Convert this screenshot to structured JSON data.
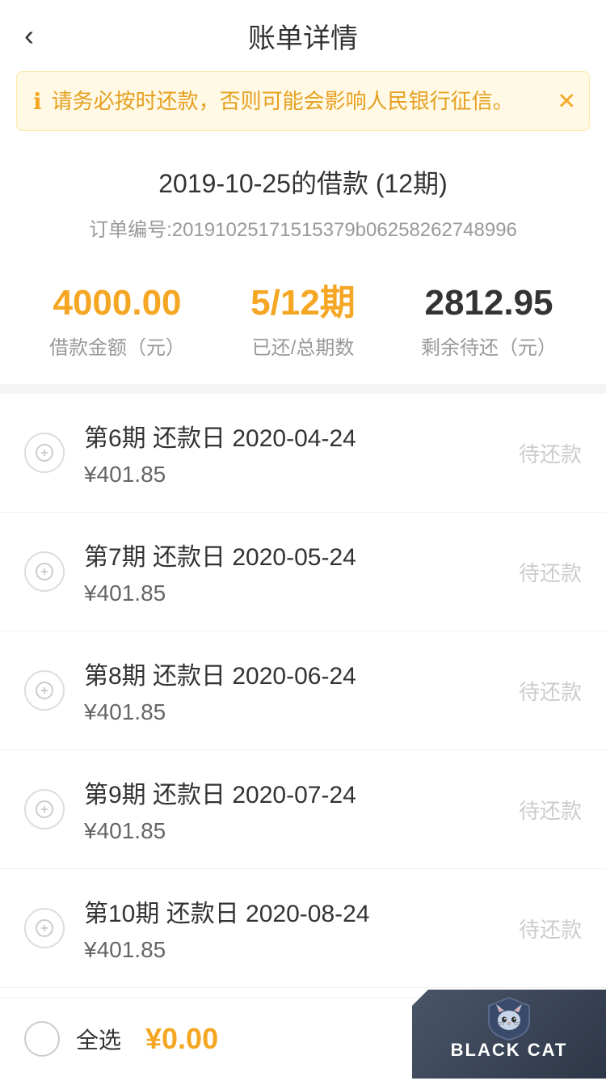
{
  "header": {
    "back_label": "‹",
    "title": "账单详情"
  },
  "warning": {
    "icon": "ℹ",
    "text": "请务必按时还款，否则可能会影响人民银行征信。",
    "close_icon": "✕"
  },
  "loan": {
    "title": "2019-10-25的借款 (12期)",
    "order_no_prefix": "订单编号:",
    "order_no": "20191025171515379b06258262748996"
  },
  "stats": {
    "amount": {
      "value": "4000.00",
      "label": "借款金额（元）"
    },
    "period": {
      "value": "5/12期",
      "label": "已还/总期数"
    },
    "remaining": {
      "value": "2812.95",
      "label": "剩余待还（元）"
    }
  },
  "installments": [
    {
      "period_label": "第6期 还款日 2020-04-24",
      "amount": "¥401.85",
      "status": "待还款"
    },
    {
      "period_label": "第7期 还款日 2020-05-24",
      "amount": "¥401.85",
      "status": "待还款"
    },
    {
      "period_label": "第8期 还款日 2020-06-24",
      "amount": "¥401.85",
      "status": "待还款"
    },
    {
      "period_label": "第9期 还款日 2020-07-24",
      "amount": "¥401.85",
      "status": "待还款"
    },
    {
      "period_label": "第10期 还款日 2020-08-24",
      "amount": "¥401.85",
      "status": "待还款"
    }
  ],
  "bottom_bar": {
    "select_all_label": "全选",
    "total_amount": "¥0.00"
  },
  "watermark": {
    "text": "BLACK CAT"
  }
}
